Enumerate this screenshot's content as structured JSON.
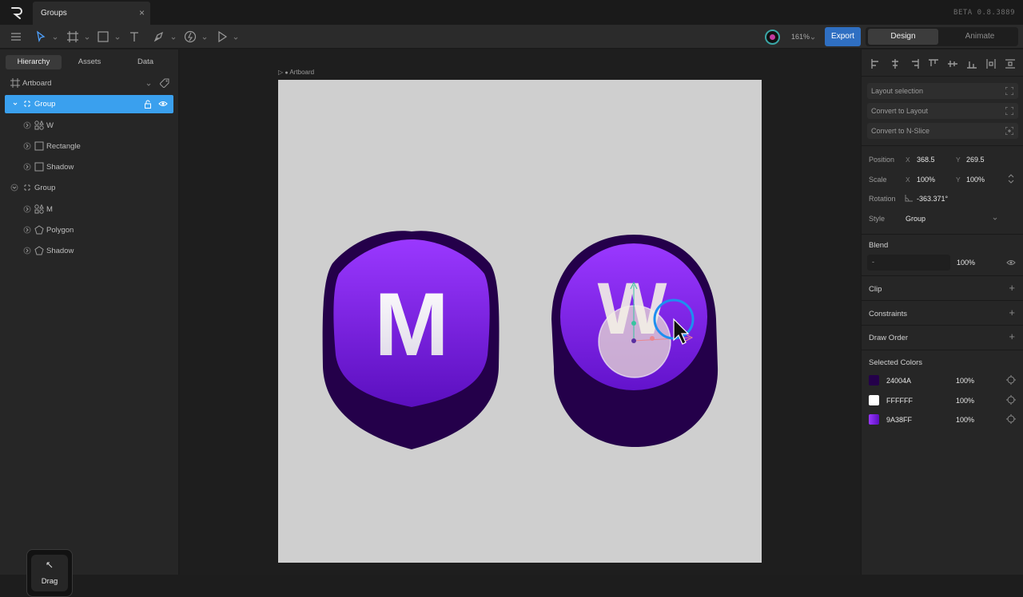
{
  "app": {
    "tab_title": "Groups",
    "tab_close": "×",
    "version": "BETA 0.8.3889"
  },
  "toolbar": {
    "zoom": "161%",
    "export_label": "Export",
    "design_label": "Design",
    "animate_label": "Animate",
    "accent": "#2f6fc2"
  },
  "left": {
    "tabs": [
      "Hierarchy",
      "Assets",
      "Data"
    ],
    "active_tab": "Hierarchy",
    "artboard": "Artboard",
    "tree": [
      {
        "label": "Group",
        "icon": "group-icon",
        "selected": true
      },
      {
        "label": "W",
        "icon": "shapes-icon"
      },
      {
        "label": "Rectangle",
        "icon": "rectangle-icon"
      },
      {
        "label": "Shadow",
        "icon": "rectangle-icon"
      },
      {
        "label": "Group",
        "icon": "group-icon"
      },
      {
        "label": "M",
        "icon": "shapes-icon"
      },
      {
        "label": "Polygon",
        "icon": "polygon-icon"
      },
      {
        "label": "Shadow",
        "icon": "polygon-icon"
      }
    ],
    "drag_hud": "Drag"
  },
  "canvas": {
    "artboard_label": "Artboard",
    "letter_m": "M",
    "letter_w": "W"
  },
  "right": {
    "layout_selection": "Layout selection",
    "convert_layout": "Convert to Layout",
    "convert_nslice": "Convert to N-Slice",
    "position_label": "Position",
    "position_x": "368.5",
    "position_y": "269.5",
    "scale_label": "Scale",
    "scale_x": "100%",
    "scale_y": "100%",
    "rotation_label": "Rotation",
    "rotation_value": "-363.371°",
    "style_label": "Style",
    "style_value": "Group",
    "axis_x": "X",
    "axis_y": "Y",
    "blend_label": "Blend",
    "blend_mode": "-",
    "blend_opacity": "100%",
    "clip_label": "Clip",
    "constraints_label": "Constraints",
    "draw_order_label": "Draw Order",
    "selected_colors_label": "Selected Colors",
    "colors": [
      {
        "hex": "24004A",
        "opacity": "100%",
        "swatch": "#24004A"
      },
      {
        "hex": "FFFFFF",
        "opacity": "100%",
        "swatch": "#FFFFFF"
      },
      {
        "hex": "9A38FF",
        "opacity": "100%",
        "swatch": "#9A38FF"
      }
    ]
  }
}
